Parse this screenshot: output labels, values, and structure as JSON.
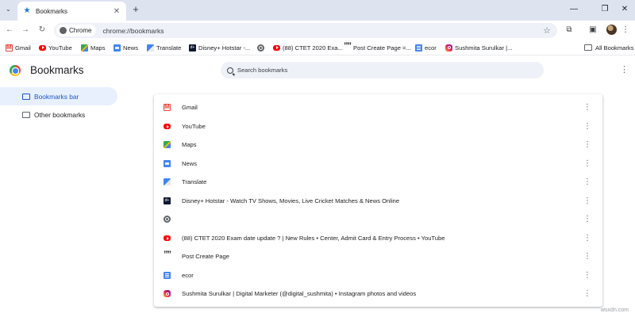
{
  "tab": {
    "title": "Bookmarks",
    "close": "✕"
  },
  "window": {
    "tab_search": "⌄",
    "new_tab": "+",
    "minimize": "—",
    "restore": "❐",
    "close": "✕"
  },
  "toolbar": {
    "back": "←",
    "forward": "→",
    "reload": "↻",
    "chip_label": "Chrome",
    "url": "chrome://bookmarks",
    "star": "☆",
    "extensions": "⧉",
    "side_panel": "▣",
    "menu": "⋮"
  },
  "bookmarks_bar": {
    "items": [
      {
        "label": "Gmail",
        "icon": "gmail-icon"
      },
      {
        "label": "YouTube",
        "icon": "youtube-icon"
      },
      {
        "label": "Maps",
        "icon": "maps-icon"
      },
      {
        "label": "News",
        "icon": "news-icon"
      },
      {
        "label": "Translate",
        "icon": "translate-icon"
      },
      {
        "label": "Disney+ Hotstar -...",
        "icon": "hotstar-icon"
      },
      {
        "label": "",
        "icon": "globe-icon"
      },
      {
        "label": "(88) CTET 2020 Exa...",
        "icon": "youtube-icon"
      },
      {
        "label": "Post Create Page =...",
        "icon": "quote-icon"
      },
      {
        "label": "ecor",
        "icon": "doc-icon"
      },
      {
        "label": "Sushmita Surulkar |...",
        "icon": "instagram-icon"
      }
    ],
    "all_bookmarks": "All Bookmarks"
  },
  "manager": {
    "title": "Bookmarks",
    "search_placeholder": "Search bookmarks",
    "menu": "⋮",
    "sidebar": [
      {
        "label": "Bookmarks bar",
        "selected": true
      },
      {
        "label": "Other bookmarks",
        "selected": false
      }
    ],
    "rows": [
      {
        "title": "Gmail",
        "icon": "gmail-icon"
      },
      {
        "title": "YouTube",
        "icon": "youtube-icon"
      },
      {
        "title": "Maps",
        "icon": "maps-icon"
      },
      {
        "title": "News",
        "icon": "news-icon"
      },
      {
        "title": "Translate",
        "icon": "translate-icon"
      },
      {
        "title": "Disney+ Hotstar - Watch TV Shows, Movies, Live Cricket Matches & News Online",
        "icon": "hotstar-icon"
      },
      {
        "title": "",
        "icon": "globe-icon"
      },
      {
        "title": "(88) CTET 2020 Exam date update ? | New Rules • Center, Admit Card & Entry Process • YouTube",
        "icon": "youtube-icon"
      },
      {
        "title": "Post Create Page",
        "icon": "quote-icon"
      },
      {
        "title": "ecor",
        "icon": "doc-icon"
      },
      {
        "title": "Sushmita Surulkar | Digital Marketer (@digital_sushmita) • Instagram photos and videos",
        "icon": "instagram-icon"
      }
    ],
    "row_menu": "⋮"
  },
  "watermark": "wsxdn.com",
  "colors": {
    "accent": "#1a73e8",
    "tabstrip": "#dee3f0",
    "selected_bg": "#e8f0fe"
  }
}
